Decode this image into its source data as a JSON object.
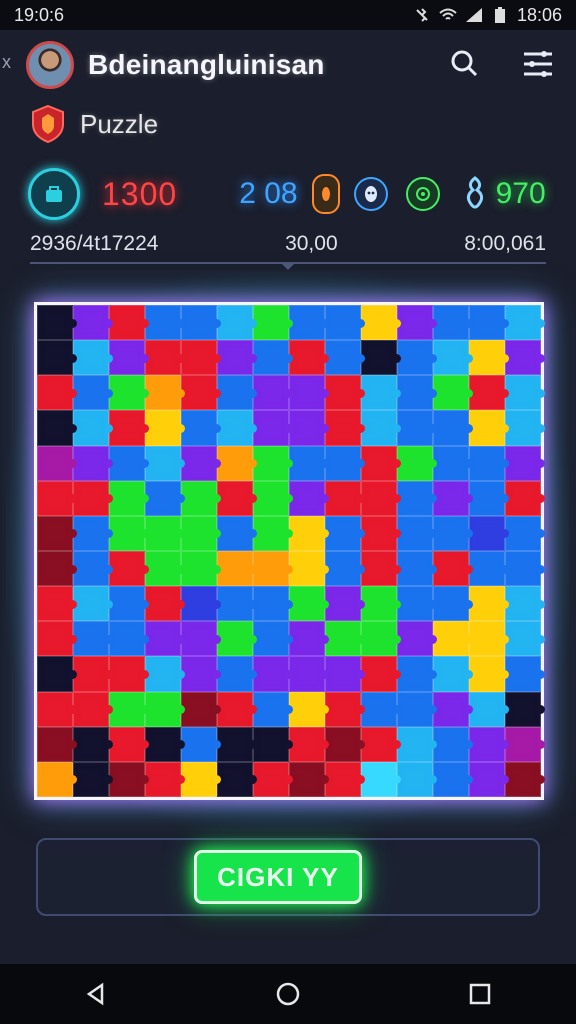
{
  "status_bar": {
    "time_left": "19:0:6",
    "time_right": "18:06",
    "icons": [
      "mute-icon",
      "wifi-icon",
      "signal-icon",
      "battery-icon"
    ]
  },
  "header": {
    "title": "Bdeinangluinisan",
    "back_symbol": "x",
    "actions": [
      "search-icon",
      "menu-icon"
    ]
  },
  "subheader": {
    "label": "Puzzle",
    "icon": "shield-icon"
  },
  "stats": {
    "score": "1300",
    "moves": "2 08",
    "gems": "970",
    "colors": {
      "score": "#ff4545",
      "moves": "#3fa6ff",
      "gems": "#44ee66"
    }
  },
  "info": {
    "left": "2936/4t17224",
    "center": "30,00",
    "right": "8:00,061"
  },
  "board": {
    "rows": 14,
    "cols": 14,
    "palette": {
      "K": "#12122e",
      "P": "#7b28ea",
      "R": "#e8192c",
      "B": "#1a72ee",
      "C": "#23b4f2",
      "G": "#1ee32e",
      "O": "#ff9c0a",
      "Y": "#ffcf0a",
      "M": "#a61aa6",
      "D": "#8a0f22",
      "N": "#2f3ee0",
      "L": "#38d9ff"
    },
    "grid": [
      "KPRBBCGBBYPBBC",
      "KCPRRPBRBKBCYP",
      "RBGORBPPRCBGRC",
      "KCRYBCPPRCBBYC",
      "MPBCPOGBBRGBBP",
      "RRGBGRGPRRBPBR",
      "DBGGGBGYBRBBNB",
      "DBRGGOOYBRBRBB",
      "RCBRNBBGPGBBYC",
      "RBBPPGBPGGPYYC",
      "KRRCPBPPPRBCYB",
      "RRGGDRBYRBBPCK",
      "DKRKBKKRDRCBPM",
      "OKDRYKRDRLCBPD"
    ]
  },
  "action": {
    "label": "CIGKI YY",
    "color": "#17e34a"
  },
  "nav": [
    "back-icon",
    "home-icon",
    "recents-icon"
  ]
}
